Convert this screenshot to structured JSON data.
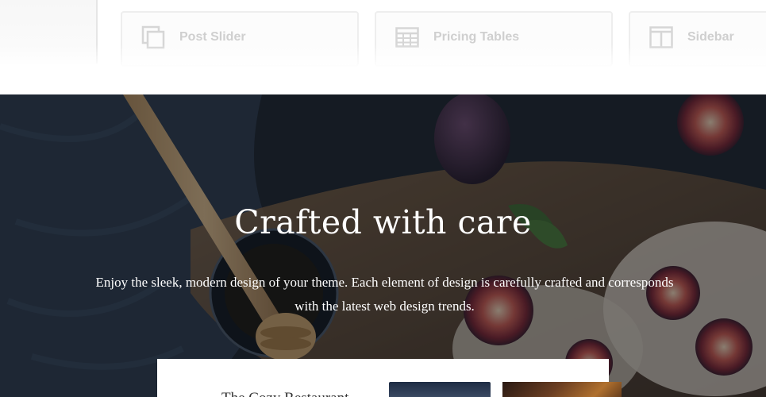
{
  "features": [
    {
      "label": "Post Slider",
      "icon": "copy-icon"
    },
    {
      "label": "Pricing Tables",
      "icon": "table-icon"
    },
    {
      "label": "Sidebar",
      "icon": "sidebar-icon"
    }
  ],
  "hero": {
    "title": "Crafted with care",
    "text": "Enjoy the sleek, modern design of your theme. Each element of design is carefully crafted and corresponds with the latest web design trends."
  },
  "card": {
    "title": "The Cozy Restaurant"
  },
  "colors": {
    "feature_text": "#cfcfcf",
    "feature_border": "#eeeeee",
    "hero_overlay": "#141a22",
    "white": "#ffffff"
  }
}
